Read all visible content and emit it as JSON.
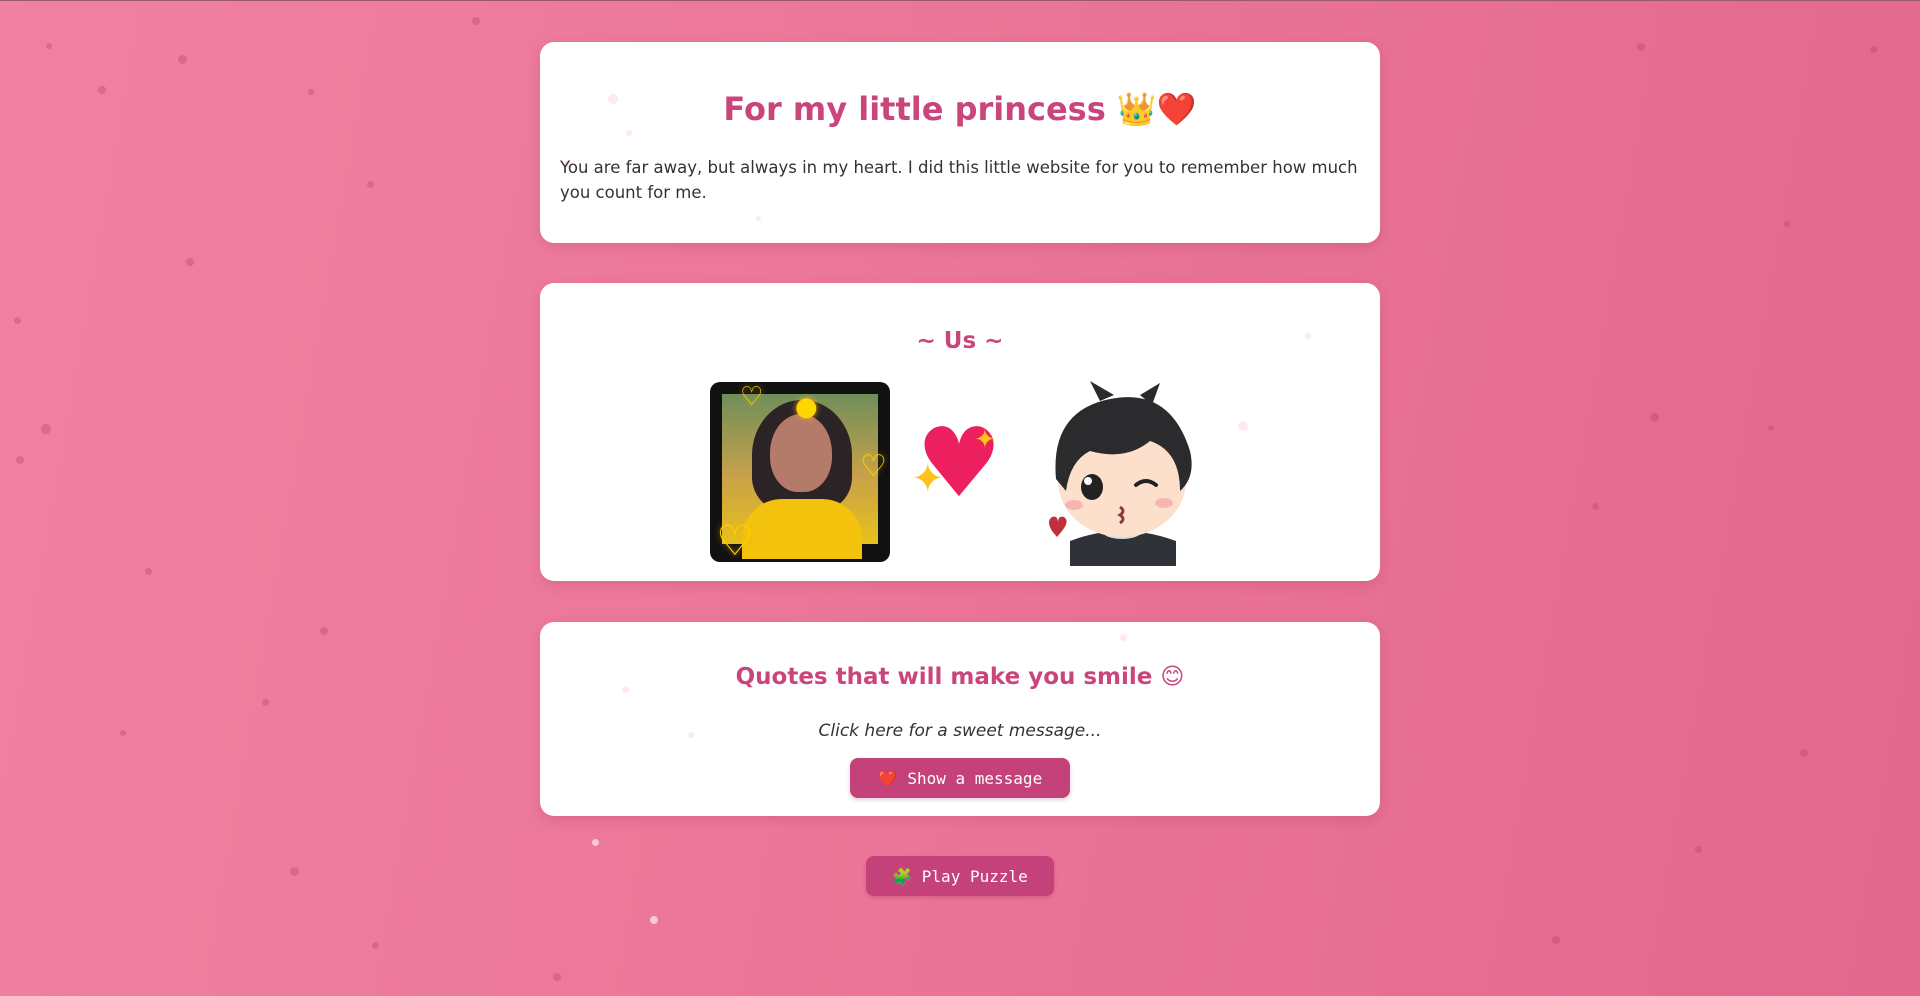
{
  "header": {
    "title": "For my little princess 👑❤️",
    "intro": "You are far away, but always in my heart. I did this little website for you to remember how much you count for me."
  },
  "us": {
    "title": "~ Us ~",
    "photo_alt": "Her photo with golden heart frame",
    "heart_icon": "sparkling-heart-icon",
    "avatar_icon": "chibi-boy-wink-icon"
  },
  "quotes": {
    "title": "Quotes that will make you smile 😊",
    "prompt": "Click here for a sweet message...",
    "button_label": "❤️ Show a message"
  },
  "puzzle": {
    "button_label": "🧩 Play Puzzle"
  },
  "colors": {
    "accent": "#c9457b",
    "button": "#c4417a",
    "background": "#ea7598",
    "heart": "#ec1f5f"
  }
}
